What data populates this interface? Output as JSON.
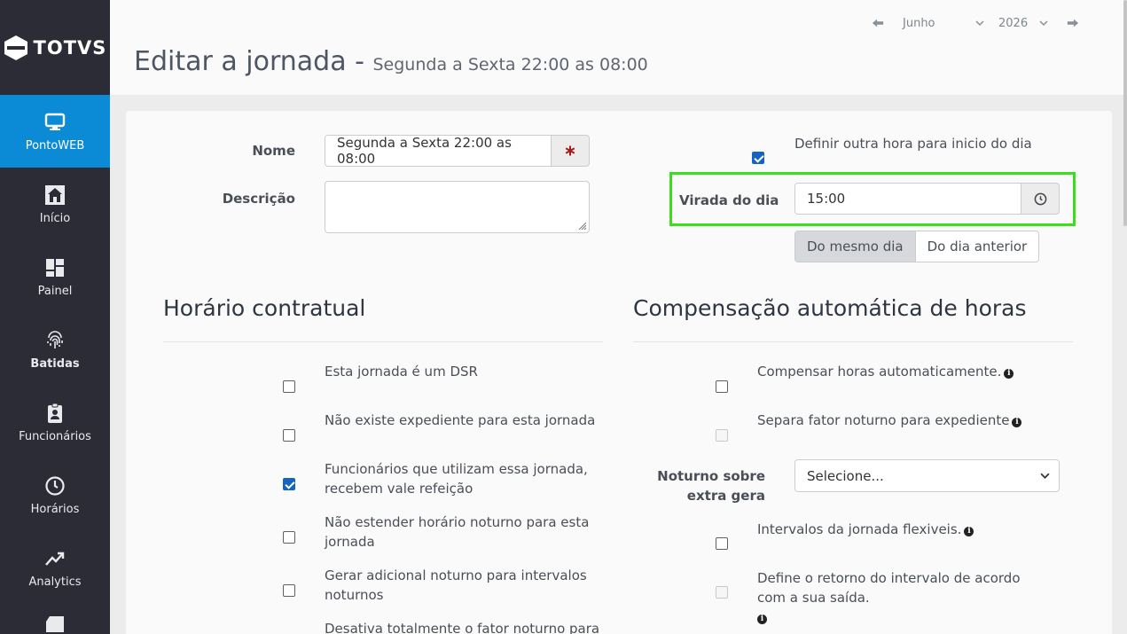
{
  "brand": {
    "name": "TOTVS"
  },
  "sidebar": {
    "items": [
      {
        "label": "PontoWEB",
        "icon": "monitor-icon",
        "active": true
      },
      {
        "label": "Início",
        "icon": "home-icon"
      },
      {
        "label": "Painel",
        "icon": "dashboard-icon"
      },
      {
        "label": "Batidas",
        "icon": "fingerprint-icon",
        "bold": true
      },
      {
        "label": "Funcionários",
        "icon": "badge-icon"
      },
      {
        "label": "Horários",
        "icon": "clock-icon"
      },
      {
        "label": "Analytics",
        "icon": "trend-icon"
      }
    ]
  },
  "header": {
    "title": "Editar a jornada -",
    "subtitle": "Segunda a Sexta 22:00 as 08:00",
    "month": "Junho",
    "year": "2026"
  },
  "form": {
    "nome_label": "Nome",
    "nome_value": "Segunda a Sexta 22:00 as 08:00",
    "descricao_label": "Descrição",
    "descricao_value": "",
    "definir_label": "Definir outra hora para inicio do dia",
    "definir_checked": true,
    "virada_label": "Virada do dia",
    "virada_value": "15:00",
    "dia_options": [
      "Do mesmo dia",
      "Do dia anterior"
    ],
    "dia_selected": "Do mesmo dia"
  },
  "contratual": {
    "title": "Horário contratual",
    "items": [
      {
        "line1": "Esta jornada é um DSR",
        "line2": "",
        "checked": false
      },
      {
        "line1": "Não existe expediente para esta jornada",
        "line2": "",
        "checked": false
      },
      {
        "line1": "Funcionários que utilizam essa jornada,",
        "line2": "recebem vale refeição",
        "checked": true
      },
      {
        "line1": "Não estender horário noturno para esta",
        "line2": "jornada",
        "checked": false
      },
      {
        "line1": "Gerar adicional noturno para intervalos",
        "line2": "noturnos",
        "checked": false
      },
      {
        "line1": "Desativa totalmente o fator noturno para",
        "line2": "",
        "checked": false
      }
    ]
  },
  "compensacao": {
    "title": "Compensação automática de horas",
    "items": [
      {
        "label": "Compensar horas automaticamente.",
        "checked": false,
        "disabled": false
      },
      {
        "label": "Separa fator noturno para expediente",
        "checked": false,
        "disabled": true
      },
      {
        "label": "Intervalos da jornada flexiveis.",
        "checked": false,
        "disabled": false
      },
      {
        "line1": "Define o retorno do intervalo de acordo",
        "line2": "com a sua saída.",
        "checked": false,
        "disabled": true
      }
    ],
    "noturno_label_1": "Noturno sobre",
    "noturno_label_2": "extra gera",
    "noturno_value": "Selecione..."
  }
}
